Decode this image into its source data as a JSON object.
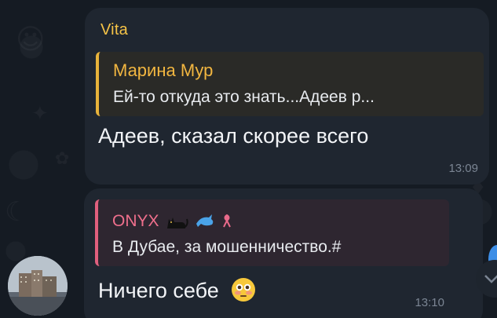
{
  "messages": [
    {
      "sender": "Vita",
      "reply": {
        "author": "Марина Мур",
        "text": "Ей-то откуда это знать...Адеев р..."
      },
      "text": "Адеев, сказал скорее всего",
      "time": "13:09"
    },
    {
      "reply": {
        "author": "ONYX",
        "text": "В Дубае, за мошенничество.#"
      },
      "text": "Ничего себе",
      "time": "13:10"
    }
  ],
  "icons": {
    "sender_avatar": "avatar-photo-buildings",
    "reply_author_emojis": [
      "black-cat-icon",
      "dolphin-icon",
      "pink-emblem-icon"
    ],
    "message_emoji": "flushed-face-icon"
  },
  "colors": {
    "background": "#151b23",
    "bubble": "#1f2630",
    "sender_name": "#f5c347",
    "reply1_accent": "#e8b33b",
    "reply2_accent": "#e0607e",
    "timestamp": "#7b8593"
  }
}
